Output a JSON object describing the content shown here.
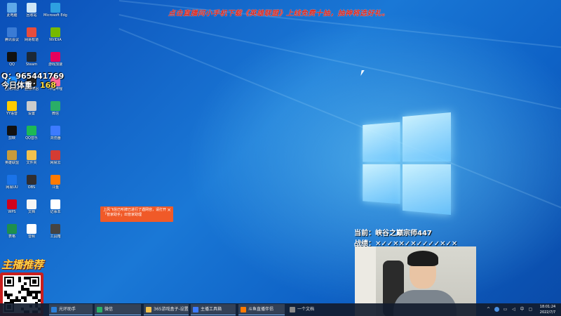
{
  "overlay": {
    "banner": "点击直播间小手机下载《英雄联盟》上线免费十抽，抽神将选好礼。",
    "qq_label": "Q：965441769",
    "today_label": "今日体重：",
    "today_value": "168",
    "promo": "主播推荐"
  },
  "streamer": {
    "current_label": "当前：",
    "current_value": "峡谷之巅宗师447",
    "record_label": "战绩：",
    "record_value": "✕✓✓✕✕✓✕✓✓✓✓✕✓✕"
  },
  "toast": {
    "text": "上风飞信已听牌已进行了遇网容，请打开「管家助手」出管家助理",
    "close": "×"
  },
  "desktop_icons": [
    {
      "label": "此电脑",
      "color": "#5fa8e8"
    },
    {
      "label": "回收站",
      "color": "#cfe6f7"
    },
    {
      "label": "Microsoft Edge",
      "color": "#2ea0e0"
    },
    {
      "label": "腾讯会议",
      "color": "#3a7bd5"
    },
    {
      "label": "网易有道",
      "color": "#e74c3c"
    },
    {
      "label": "NVIDIA",
      "color": "#76b900"
    },
    {
      "label": "QQ",
      "color": "#111111"
    },
    {
      "label": "Steam",
      "color": "#1b2838"
    },
    {
      "label": "游戏加速",
      "color": "#e6005c"
    },
    {
      "label": "应用商店",
      "color": "#1e90ff"
    },
    {
      "label": "直播伴侣",
      "color": "#222222"
    },
    {
      "label": "哔哩哔哩",
      "color": "#ff6699"
    },
    {
      "label": "YY语音",
      "color": "#ffcc00"
    },
    {
      "label": "设置",
      "color": "#cccccc"
    },
    {
      "label": "微信",
      "color": "#2aae67"
    },
    {
      "label": "剪映",
      "color": "#111111"
    },
    {
      "label": "QQ音乐",
      "color": "#1db954"
    },
    {
      "label": "浏览器",
      "color": "#3d7bff"
    },
    {
      "label": "英雄联盟",
      "color": "#c79b3b"
    },
    {
      "label": "文件夹",
      "color": "#f2c14e"
    },
    {
      "label": "网易云",
      "color": "#d43c33"
    },
    {
      "label": "网易UU",
      "color": "#1a73e8"
    },
    {
      "label": "OBS",
      "color": "#302e31"
    },
    {
      "label": "斗鱼",
      "color": "#ff7a00"
    },
    {
      "label": "WPS",
      "color": "#d0021b"
    },
    {
      "label": "文档",
      "color": "#f5f5f5"
    },
    {
      "label": "记事本",
      "color": "#ffffff"
    },
    {
      "label": "表格",
      "color": "#1e8f4e"
    },
    {
      "label": "音频",
      "color": "#ffffff"
    },
    {
      "label": "工具箱",
      "color": "#444444"
    }
  ],
  "taskbar": {
    "items": [
      {
        "label": "光环助手",
        "color": "#2b7fd8"
      },
      {
        "label": "微信",
        "color": "#2aae67"
      },
      {
        "label": "365游戏盒子-设置",
        "color": "#f2c14e"
      },
      {
        "label": "主播工具箱",
        "color": "#3d7bff"
      },
      {
        "label": "斗鱼直播伴侣",
        "color": "#ff7a00"
      },
      {
        "label": "一个文档",
        "color": "#888888"
      }
    ],
    "time": "18:01:24",
    "date": "2022/7/7"
  }
}
